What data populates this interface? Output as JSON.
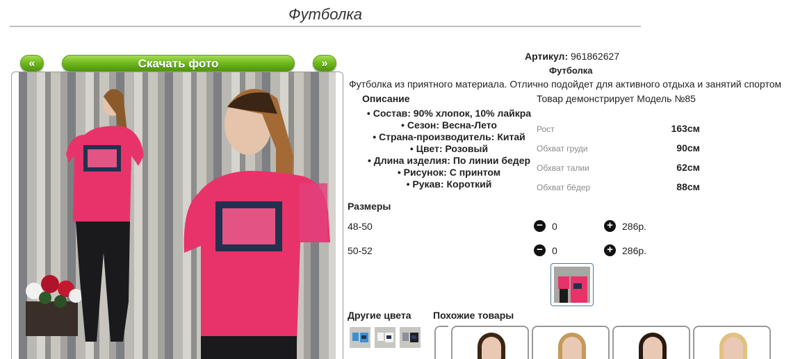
{
  "page": {
    "title": "Футболка"
  },
  "gallery": {
    "prev_label": "«",
    "download_label": "Скачать фото",
    "next_label": "»"
  },
  "product": {
    "article_label": "Артикул:",
    "article_value": "961862627",
    "name": "Футболка",
    "description": "Футболка из приятного материала. Отлично подойдет для активного отдыха и занятий спортом",
    "description_heading": "Описание",
    "model_note": "Товар демонстрирует Модель №85",
    "attributes": [
      "Состав: 90% хлопок, 10% лайкра",
      "Сезон: Весна-Лето",
      "Страна-производитель: Китай",
      "Цвет: Розовый",
      "Длина изделия: По линии бедер",
      "Рисунок: С принтом",
      "Рукав: Короткий"
    ],
    "measurements": [
      {
        "label": "Рост",
        "value": "163см"
      },
      {
        "label": "Обхват груди",
        "value": "90см"
      },
      {
        "label": "Обхват талии",
        "value": "62см"
      },
      {
        "label": "Обхват бёдер",
        "value": "88см"
      }
    ]
  },
  "sizes": {
    "heading": "Размеры",
    "rows": [
      {
        "size": "48-50",
        "qty": "0",
        "price": "286р."
      },
      {
        "size": "50-52",
        "qty": "0",
        "price": "286р."
      }
    ],
    "minus_icon": "minus-circle-icon",
    "plus_icon": "plus-circle-icon"
  },
  "other_colors": {
    "heading": "Другие цвета",
    "count": 3
  },
  "similar": {
    "heading": "Похожие товары",
    "count": 4
  },
  "colors": {
    "accent_green": "#6fb81c",
    "shirt_pink": "#e8336a",
    "denim": "#22314f"
  }
}
